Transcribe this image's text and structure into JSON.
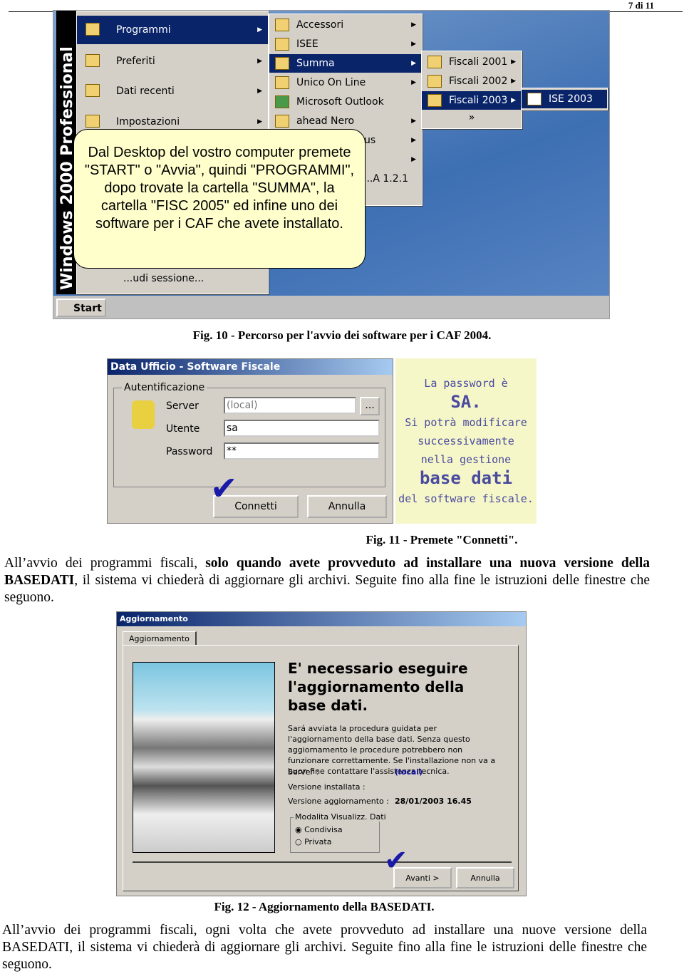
{
  "header": {
    "page_number": "7 di 11"
  },
  "fig10": {
    "sidebar_text": "Windows 2000 Professional",
    "start_menu": [
      "Programmi",
      "Preferiti",
      "Dati recenti",
      "Impostazioni"
    ],
    "start_menu_bottom": "...udi sessione...",
    "programs": [
      "Accessori",
      "ISEE",
      "Summa",
      "Unico On Line",
      "Microsoft Outlook",
      "ahead Nero",
      "...irus",
      "",
      "...A 1.2.1"
    ],
    "summa_items": [
      "Fiscali 2001",
      "Fiscali 2002",
      "Fiscali 2003",
      "»"
    ],
    "fiscali2003_items": [
      "ISE 2003"
    ],
    "bubble_text": "Dal Desktop del vostro computer premete \"START\" o \"Avvia\", quindi \"PROGRAMMI\", dopo trovate la cartella \"SUMMA\", la cartella \"FISC 2005\" ed infine uno dei software per i CAF che avete installato.",
    "start_label": "Start",
    "caption": "Fig. 10 - Percorso per l'avvio dei software per i CAF 2004."
  },
  "fig11": {
    "title": "Data Ufficio - Software Fiscale",
    "group": "Autentificazione",
    "server_label": "Server",
    "server_value": "(local)",
    "browse": "...",
    "user_label": "Utente",
    "user_value": "sa",
    "password_label": "Password",
    "password_value": "**",
    "connect": "Connetti",
    "cancel": "Annulla",
    "note": {
      "line1": "La password è",
      "line2": "SA.",
      "line3": "Si potrà modificare",
      "line4": "successivamente",
      "line5": "nella gestione",
      "line6": "base dati",
      "line7": "del software fiscale."
    },
    "caption": "Fig. 11 - Premete \"Connetti\"."
  },
  "para1": {
    "a": "All’avvio dei programmi fiscali, ",
    "b": "solo quando avete provveduto ad installare una nuova versione della BASEDATI",
    "c": ", il sistema vi chiederà di aggiornare gli archivi. Seguite fino alla fine le istruzioni delle finestre che seguono."
  },
  "fig12": {
    "title": "Aggiornamento",
    "tab": "Aggiornamento",
    "heading": "E' necessario eseguire l'aggiornamento della base dati.",
    "body": "Sará avviata la procedura guidata per l'aggiornamento della base dati. Senza questo aggiornamento le procedure potrebbero non funzionare correttamente. Se l'installazione non va a buon fine contattare l'assistenza tecnica.",
    "server_label": "Server :",
    "server_value": "(local)",
    "installed_label": "Versione installata :",
    "update_label": "Versione aggiornamento :",
    "update_value": "28/01/2003 16.45",
    "mode_group": "Modalita Visualizz. Dati",
    "mode_options": [
      "Condivisa",
      "Privata"
    ],
    "mode_selected": "Condivisa",
    "next": "Avanti >",
    "cancel": "Annulla",
    "caption": "Fig. 12 - Aggiornamento della BASEDATI."
  },
  "para2": "All’avvio dei programmi fiscali, ogni volta che avete provveduto ad installare una nuove versione della BASEDATI, il sistema vi chiederà di aggiornare gli archivi. Seguite fino alla fine le istruzioni delle finestre che seguono."
}
